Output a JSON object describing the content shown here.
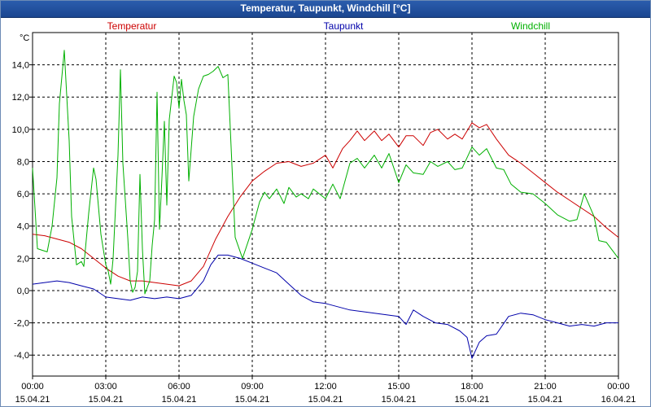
{
  "window": {
    "title": "Temperatur, Taupunkt, Windchill [°C]"
  },
  "chart_data": {
    "type": "line",
    "title": "Temperatur, Taupunkt, Windchill [°C]",
    "ylabel": "°C",
    "ylim": [
      -5.3,
      16.0
    ],
    "yticks": [
      14,
      12,
      10,
      8,
      6,
      4,
      2,
      0,
      -2,
      -4
    ],
    "ytick_labels": [
      "14,0",
      "12,0",
      "10,0",
      "8,0",
      "6,0",
      "4,0",
      "2,0",
      "0,0",
      "-2,0",
      "-4,0"
    ],
    "xlim": [
      0,
      24
    ],
    "xticks": [
      0,
      3,
      6,
      9,
      12,
      15,
      18,
      21,
      24
    ],
    "xtick_time_labels": [
      "00:00",
      "03:00",
      "06:00",
      "09:00",
      "12:00",
      "15:00",
      "18:00",
      "21:00",
      "00:00"
    ],
    "xtick_date_labels": [
      "15.04.21",
      "15.04.21",
      "15.04.21",
      "15.04.21",
      "15.04.21",
      "15.04.21",
      "15.04.21",
      "15.04.21",
      "16.04.21"
    ],
    "grid": true,
    "legend": "top",
    "series": [
      {
        "name": "Temperatur",
        "color": "#cc0000",
        "points": [
          [
            0,
            3.5
          ],
          [
            0.5,
            3.4
          ],
          [
            1,
            3.2
          ],
          [
            1.5,
            3.0
          ],
          [
            2,
            2.6
          ],
          [
            2.5,
            2.0
          ],
          [
            3,
            1.4
          ],
          [
            3.5,
            0.9
          ],
          [
            4,
            0.6
          ],
          [
            4.5,
            0.6
          ],
          [
            5,
            0.5
          ],
          [
            5.5,
            0.4
          ],
          [
            6,
            0.3
          ],
          [
            6.5,
            0.6
          ],
          [
            7,
            1.5
          ],
          [
            7.5,
            3.2
          ],
          [
            8,
            4.6
          ],
          [
            8.5,
            5.8
          ],
          [
            9,
            6.8
          ],
          [
            9.5,
            7.4
          ],
          [
            10,
            7.9
          ],
          [
            10.5,
            8.0
          ],
          [
            11,
            7.7
          ],
          [
            11.5,
            7.9
          ],
          [
            12,
            8.4
          ],
          [
            12.3,
            7.6
          ],
          [
            12.7,
            8.8
          ],
          [
            13,
            9.3
          ],
          [
            13.3,
            9.9
          ],
          [
            13.6,
            9.3
          ],
          [
            14,
            9.9
          ],
          [
            14.3,
            9.3
          ],
          [
            14.6,
            9.7
          ],
          [
            15,
            8.9
          ],
          [
            15.3,
            9.6
          ],
          [
            15.6,
            9.6
          ],
          [
            16,
            9.0
          ],
          [
            16.3,
            9.8
          ],
          [
            16.6,
            10.0
          ],
          [
            17,
            9.4
          ],
          [
            17.3,
            9.7
          ],
          [
            17.6,
            9.4
          ],
          [
            18,
            10.4
          ],
          [
            18.3,
            10.1
          ],
          [
            18.6,
            10.3
          ],
          [
            19,
            9.4
          ],
          [
            19.5,
            8.4
          ],
          [
            20,
            7.9
          ],
          [
            20.5,
            7.3
          ],
          [
            21,
            6.7
          ],
          [
            21.5,
            6.1
          ],
          [
            22,
            5.6
          ],
          [
            22.5,
            5.1
          ],
          [
            23,
            4.6
          ],
          [
            23.5,
            3.9
          ],
          [
            24,
            3.3
          ]
        ]
      },
      {
        "name": "Taupunkt",
        "color": "#0000aa",
        "points": [
          [
            0,
            0.4
          ],
          [
            0.5,
            0.5
          ],
          [
            1,
            0.6
          ],
          [
            1.5,
            0.5
          ],
          [
            2,
            0.3
          ],
          [
            2.5,
            0.1
          ],
          [
            3,
            -0.4
          ],
          [
            3.5,
            -0.5
          ],
          [
            4,
            -0.6
          ],
          [
            4.5,
            -0.4
          ],
          [
            5,
            -0.5
          ],
          [
            5.5,
            -0.4
          ],
          [
            6,
            -0.5
          ],
          [
            6.5,
            -0.3
          ],
          [
            7,
            0.6
          ],
          [
            7.3,
            1.6
          ],
          [
            7.6,
            2.2
          ],
          [
            8,
            2.2
          ],
          [
            8.5,
            2.0
          ],
          [
            9,
            1.7
          ],
          [
            9.5,
            1.4
          ],
          [
            10,
            1.1
          ],
          [
            10.5,
            0.4
          ],
          [
            11,
            -0.3
          ],
          [
            11.5,
            -0.7
          ],
          [
            12,
            -0.8
          ],
          [
            12.5,
            -1.0
          ],
          [
            13,
            -1.2
          ],
          [
            13.5,
            -1.3
          ],
          [
            14,
            -1.4
          ],
          [
            14.5,
            -1.5
          ],
          [
            15,
            -1.6
          ],
          [
            15.3,
            -2.1
          ],
          [
            15.6,
            -1.2
          ],
          [
            16,
            -1.6
          ],
          [
            16.5,
            -2.0
          ],
          [
            17,
            -2.1
          ],
          [
            17.5,
            -2.5
          ],
          [
            17.8,
            -2.9
          ],
          [
            18,
            -4.2
          ],
          [
            18.3,
            -3.2
          ],
          [
            18.6,
            -2.8
          ],
          [
            19,
            -2.7
          ],
          [
            19.5,
            -1.6
          ],
          [
            20,
            -1.4
          ],
          [
            20.5,
            -1.5
          ],
          [
            21,
            -1.8
          ],
          [
            21.5,
            -2.0
          ],
          [
            22,
            -2.2
          ],
          [
            22.5,
            -2.1
          ],
          [
            23,
            -2.2
          ],
          [
            23.5,
            -2.0
          ],
          [
            24,
            -2.0
          ]
        ]
      },
      {
        "name": "Windchill",
        "color": "#00b000",
        "points": [
          [
            0,
            7.6
          ],
          [
            0.2,
            2.6
          ],
          [
            0.4,
            2.5
          ],
          [
            0.6,
            2.4
          ],
          [
            0.8,
            4.0
          ],
          [
            1,
            7.0
          ],
          [
            1.1,
            11.6
          ],
          [
            1.3,
            14.9
          ],
          [
            1.5,
            9.3
          ],
          [
            1.6,
            4.6
          ],
          [
            1.8,
            1.6
          ],
          [
            2,
            1.8
          ],
          [
            2.1,
            1.5
          ],
          [
            2.3,
            4.8
          ],
          [
            2.5,
            7.6
          ],
          [
            2.6,
            6.9
          ],
          [
            2.8,
            3.5
          ],
          [
            3,
            1.6
          ],
          [
            3.1,
            1.2
          ],
          [
            3.2,
            0.4
          ],
          [
            3.3,
            2.0
          ],
          [
            3.5,
            8.4
          ],
          [
            3.6,
            13.7
          ],
          [
            3.7,
            7.9
          ],
          [
            3.9,
            3.3
          ],
          [
            4,
            0.6
          ],
          [
            4.1,
            -0.1
          ],
          [
            4.2,
            0.2
          ],
          [
            4.3,
            1.2
          ],
          [
            4.4,
            7.2
          ],
          [
            4.5,
            2.6
          ],
          [
            4.6,
            -0.2
          ],
          [
            4.8,
            0.6
          ],
          [
            4.9,
            2.8
          ],
          [
            5,
            4.4
          ],
          [
            5.1,
            12.3
          ],
          [
            5.2,
            3.8
          ],
          [
            5.3,
            7.0
          ],
          [
            5.4,
            10.5
          ],
          [
            5.5,
            5.3
          ],
          [
            5.6,
            10.6
          ],
          [
            5.8,
            13.3
          ],
          [
            5.9,
            12.9
          ],
          [
            6,
            11.3
          ],
          [
            6.1,
            13.1
          ],
          [
            6.2,
            11.8
          ],
          [
            6.3,
            10.9
          ],
          [
            6.4,
            6.8
          ],
          [
            6.6,
            10.8
          ],
          [
            6.8,
            12.5
          ],
          [
            7,
            13.3
          ],
          [
            7.2,
            13.4
          ],
          [
            7.4,
            13.6
          ],
          [
            7.6,
            13.9
          ],
          [
            7.8,
            13.2
          ],
          [
            8,
            13.4
          ],
          [
            8.3,
            3.3
          ],
          [
            8.6,
            2.0
          ],
          [
            9,
            3.8
          ],
          [
            9.3,
            5.5
          ],
          [
            9.5,
            6.1
          ],
          [
            9.7,
            5.7
          ],
          [
            10,
            6.3
          ],
          [
            10.3,
            5.4
          ],
          [
            10.5,
            6.4
          ],
          [
            10.8,
            5.8
          ],
          [
            11,
            6.0
          ],
          [
            11.3,
            5.7
          ],
          [
            11.5,
            6.3
          ],
          [
            12,
            5.7
          ],
          [
            12.3,
            6.6
          ],
          [
            12.6,
            5.7
          ],
          [
            13,
            7.9
          ],
          [
            13.3,
            8.2
          ],
          [
            13.6,
            7.6
          ],
          [
            14,
            8.4
          ],
          [
            14.3,
            7.6
          ],
          [
            14.6,
            8.5
          ],
          [
            15,
            6.7
          ],
          [
            15.3,
            7.8
          ],
          [
            15.6,
            7.3
          ],
          [
            16,
            7.2
          ],
          [
            16.3,
            8.0
          ],
          [
            16.6,
            7.7
          ],
          [
            17,
            8.0
          ],
          [
            17.3,
            7.5
          ],
          [
            17.6,
            7.6
          ],
          [
            18,
            8.9
          ],
          [
            18.3,
            8.4
          ],
          [
            18.6,
            8.8
          ],
          [
            19,
            7.6
          ],
          [
            19.3,
            7.5
          ],
          [
            19.6,
            6.6
          ],
          [
            20,
            6.1
          ],
          [
            20.5,
            6.0
          ],
          [
            21,
            5.4
          ],
          [
            21.5,
            4.7
          ],
          [
            22,
            4.3
          ],
          [
            22.3,
            4.4
          ],
          [
            22.6,
            6.0
          ],
          [
            23,
            4.6
          ],
          [
            23.2,
            3.1
          ],
          [
            23.5,
            3.0
          ],
          [
            24,
            2.0
          ]
        ]
      }
    ]
  }
}
